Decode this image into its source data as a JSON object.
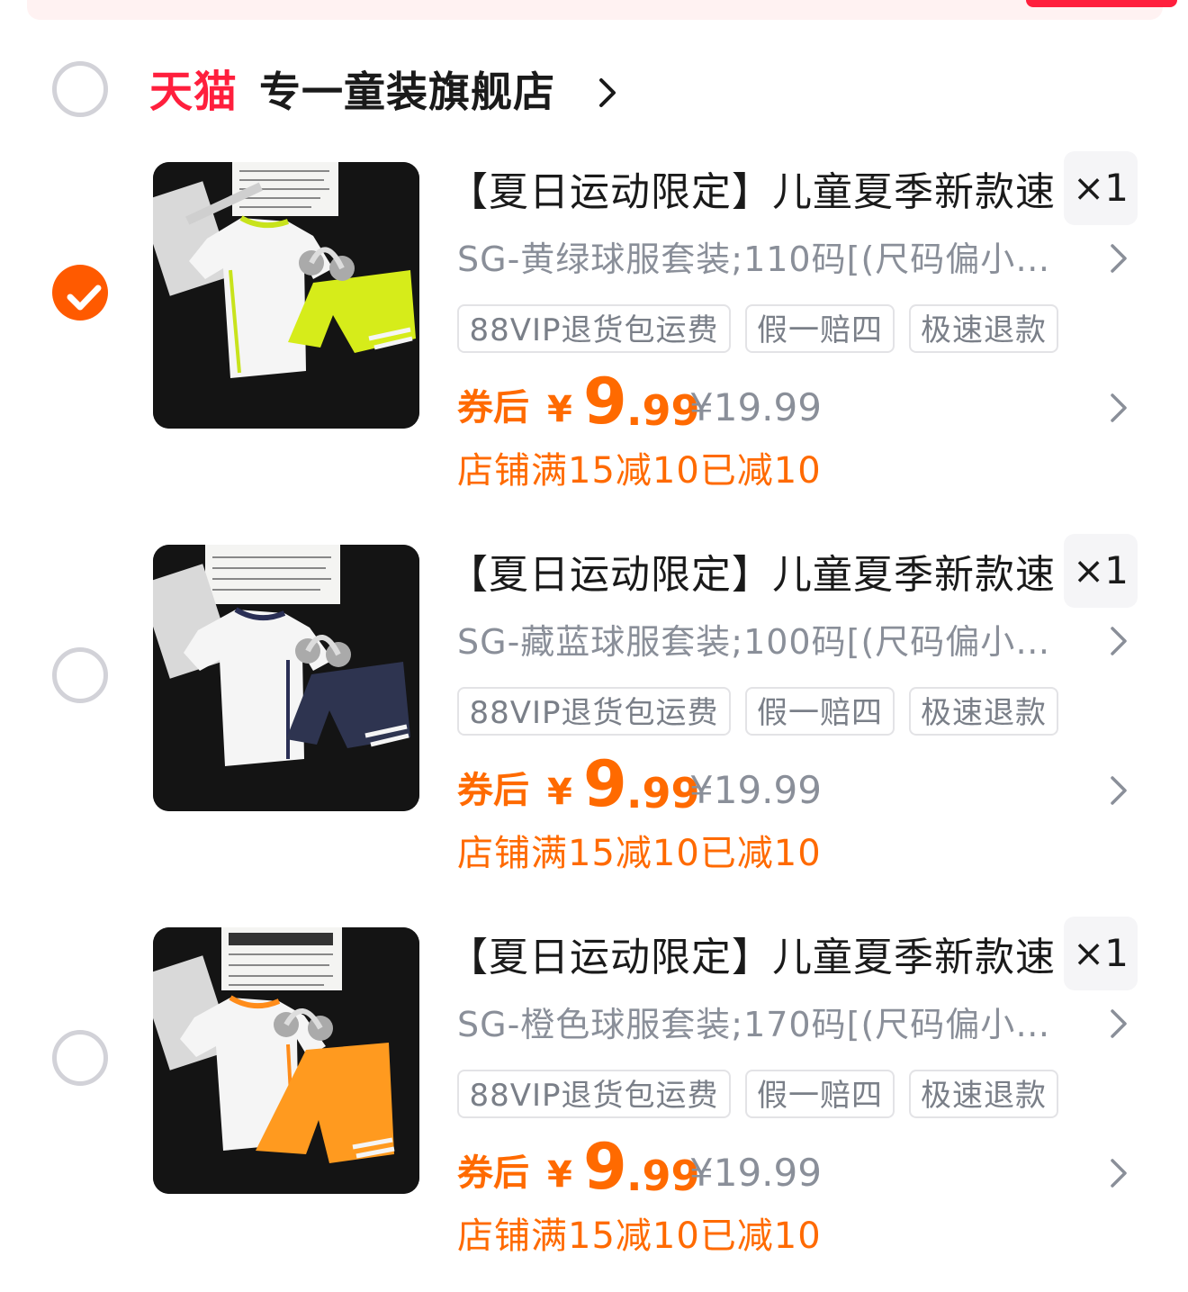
{
  "shop": {
    "logo_text": "天猫",
    "name": "专一童装旗舰店",
    "selected": false
  },
  "colors": {
    "accent": "#ff6a00",
    "tmall_red": "#ff1f3d",
    "checked": "#ff5a00",
    "muted": "#8a8f99"
  },
  "items": [
    {
      "title": "【夏日运动限定】儿童夏季新款速",
      "quantity": "×1",
      "sku": "SG-黄绿球服套装;110码[(尺码偏小…",
      "tags": [
        "88VIP退货包运费",
        "假一赔四",
        "极速退款"
      ],
      "coupon_label": "券后",
      "currency": "¥",
      "price_int": "9",
      "price_dec": ".99",
      "original_price": "¥19.99",
      "promo": "店铺满15减10已减10",
      "selected": true,
      "shorts_color": "#d6ec1a",
      "trim_color": "#c8e31c"
    },
    {
      "title": "【夏日运动限定】儿童夏季新款速",
      "quantity": "×1",
      "sku": "SG-藏蓝球服套装;100码[(尺码偏小…",
      "tags": [
        "88VIP退货包运费",
        "假一赔四",
        "极速退款"
      ],
      "coupon_label": "券后",
      "currency": "¥",
      "price_int": "9",
      "price_dec": ".99",
      "original_price": "¥19.99",
      "promo": "店铺满15减10已减10",
      "selected": false,
      "shorts_color": "#2e3450",
      "trim_color": "#2a2f55"
    },
    {
      "title": "【夏日运动限定】儿童夏季新款速",
      "quantity": "×1",
      "sku": "SG-橙色球服套装;170码[(尺码偏小…",
      "tags": [
        "88VIP退货包运费",
        "假一赔四",
        "极速退款"
      ],
      "coupon_label": "券后",
      "currency": "¥",
      "price_int": "9",
      "price_dec": ".99",
      "original_price": "¥19.99",
      "promo": "店铺满15减10已减10",
      "selected": false,
      "shorts_color": "#ff9a1f",
      "trim_color": "#ff8c1a"
    }
  ]
}
